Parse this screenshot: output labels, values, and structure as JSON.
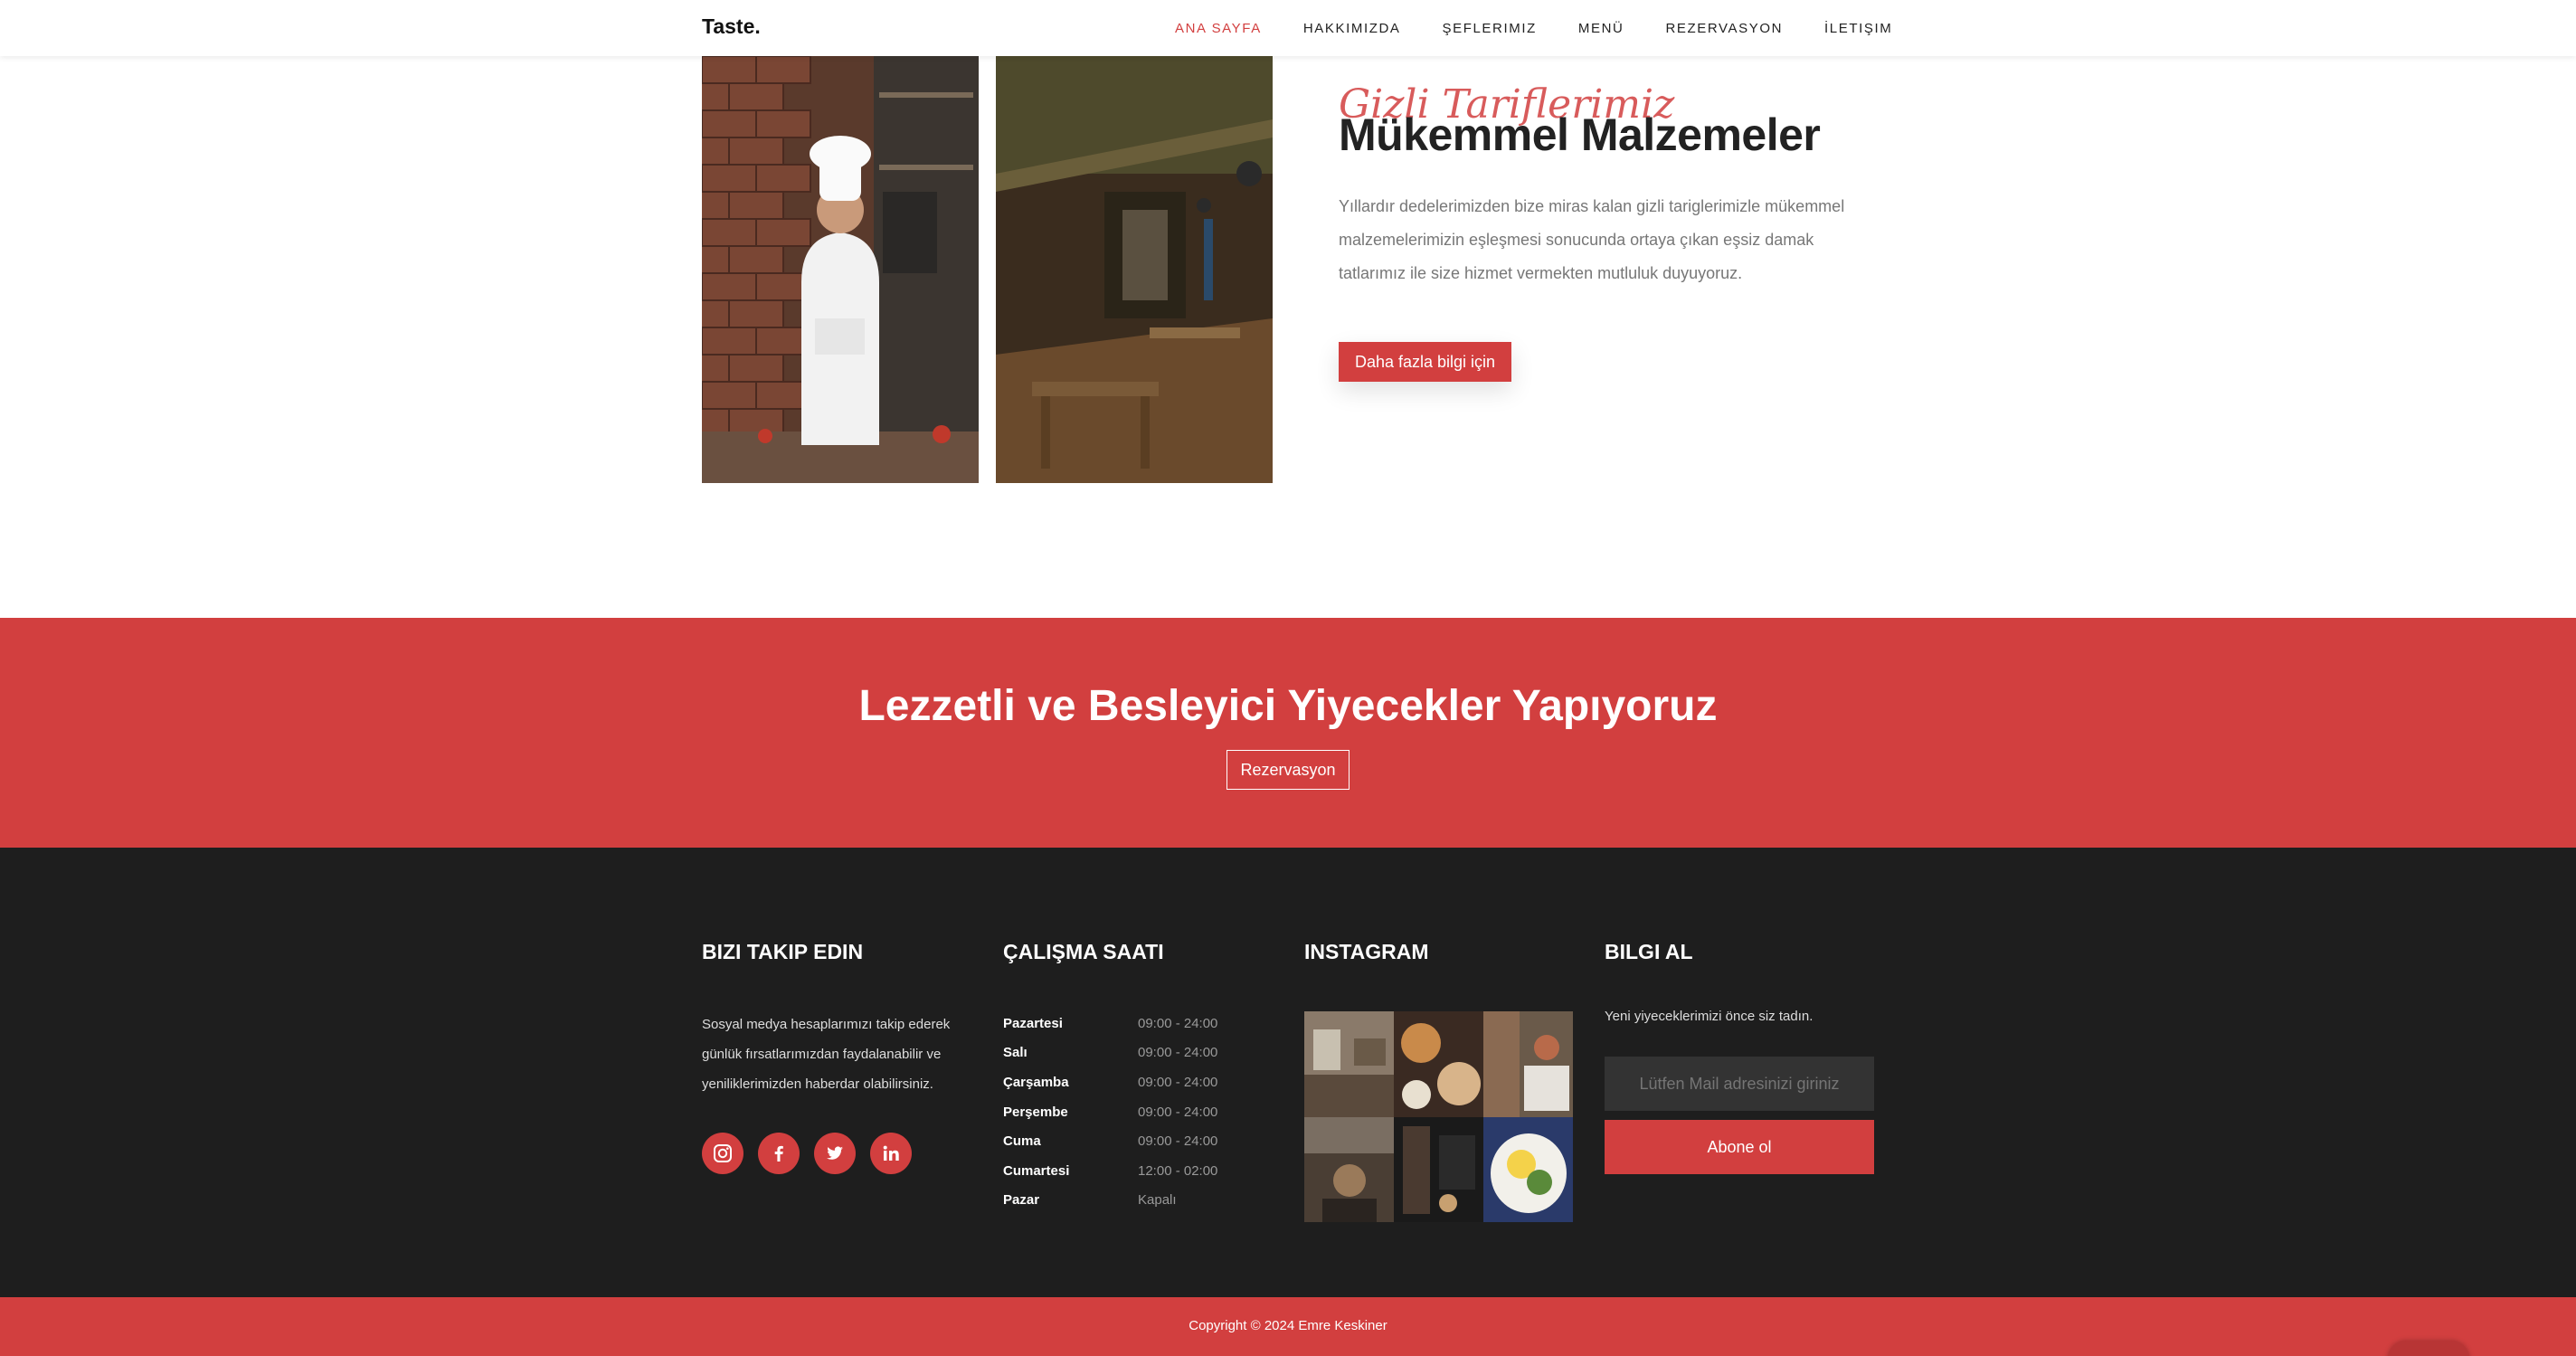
{
  "navbar": {
    "brand": "Taste.",
    "items": [
      {
        "label": "ANA SAYFA",
        "active": true
      },
      {
        "label": "HAKKIMIZDA"
      },
      {
        "label": "ŞEFLERIMIZ"
      },
      {
        "label": "MENÜ"
      },
      {
        "label": "REZERVASYON"
      },
      {
        "label": "İLETIŞIM"
      }
    ]
  },
  "about": {
    "script_title": "Gizli Tariflerimiz",
    "heading": "Mükemmel Malzemeler",
    "paragraph": "Yıllardır dedelerimizden bize miras kalan gizli tariglerimizle mükemmel malzemelerimizin eşleşmesi sonucunda ortaya çıkan eşsiz damak tatlarımız ile size hizmet vermekten mutluluk duyuyoruz.",
    "button": "Daha fazla bilgi için"
  },
  "banner": {
    "title": "Lezzetli ve Besleyici Yiyecekler Yapıyoruz",
    "button": "Rezervasyon"
  },
  "footer": {
    "follow": {
      "title": "BIZI TAKIP EDIN",
      "text": "Sosyal medya hesaplarımızı takip ederek günlük fırsatlarımızdan faydalanabilir ve yeniliklerimizden haberdar olabilirsiniz.",
      "socials": [
        "instagram-icon",
        "facebook-icon",
        "twitter-icon",
        "linkedin-icon"
      ]
    },
    "hours": {
      "title": "ÇALIŞMA SAATI",
      "rows": [
        {
          "day": "Pazartesi",
          "time": "09:00 - 24:00"
        },
        {
          "day": "Salı",
          "time": "09:00 - 24:00"
        },
        {
          "day": "Çarşamba",
          "time": "09:00 - 24:00"
        },
        {
          "day": "Perşembe",
          "time": "09:00 - 24:00"
        },
        {
          "day": "Cuma",
          "time": "09:00 - 24:00"
        },
        {
          "day": "Cumartesi",
          "time": "12:00 - 02:00"
        },
        {
          "day": "Pazar",
          "time": "Kapalı"
        }
      ]
    },
    "instagram": {
      "title": "INSTAGRAM"
    },
    "newsletter": {
      "title": "BILGI AL",
      "text": "Yeni yiyeceklerimizi önce siz tadın.",
      "placeholder": "Lütfen Mail adresinizi giriniz",
      "button": "Abone ol"
    }
  },
  "copyright": "Copyright © 2024 Emre Keskiner",
  "colors": {
    "accent": "#d23f3f",
    "footer_bg": "#1e1e1e"
  }
}
